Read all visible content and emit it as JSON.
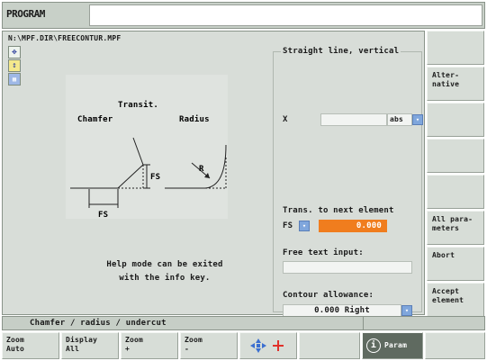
{
  "title": "PROGRAM",
  "path": "N:\\MPF.DIR\\FREECONTUR.MPF",
  "side_icons": [
    "move-icon",
    "cursor-yellow-icon",
    "grid-icon"
  ],
  "help": {
    "heading": "Transit.",
    "chamfer_label": "Chamfer",
    "radius_label": "Radius",
    "r_label": "R",
    "fs_label": "FS",
    "fs_label2": "FS",
    "text_line1": "Help mode can be exited",
    "text_line2": "with the info key."
  },
  "params": {
    "frame_title": "Straight line, vertical",
    "x_label": "X",
    "x_value": "",
    "x_unit": "abs",
    "trans_label": "Trans. to next element",
    "trans_type": "FS",
    "trans_value": "0.000",
    "free_text_label": "Free text input:",
    "free_text_value": "",
    "contour_label": "Contour allowance:",
    "contour_value": "0.000 Right"
  },
  "softkeys": {
    "k1": "",
    "k2": "Alter-\nnative",
    "k3": "",
    "k4": "",
    "k5": "",
    "k6": "All para-\nmeters",
    "k7": "Abort",
    "k8": "Accept\nelement"
  },
  "status": "Chamfer / radius / undercut",
  "hkeys": {
    "zoom_auto": "Zoom\nAuto",
    "display_all": "Display\nAll",
    "zoom_plus": "Zoom\n+",
    "zoom_minus": "Zoom\n-",
    "param": "Param"
  },
  "colors": {
    "accent": "#f07d1e",
    "dropdown": "#7fa6dc",
    "panel": "#d8ddd8"
  }
}
